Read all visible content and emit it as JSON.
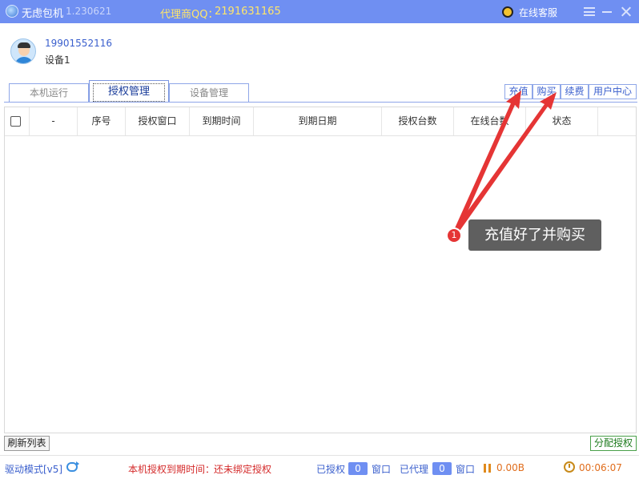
{
  "titlebar": {
    "app_name": "无虑包机",
    "version": "1.230621",
    "agent_label": "代理商QQ：",
    "agent_qq": "2191631165",
    "service_label": "在线客服"
  },
  "user": {
    "phone": "19901552116",
    "device": "设备1"
  },
  "tabs": [
    {
      "label": "本机运行"
    },
    {
      "label": "授权管理"
    },
    {
      "label": "设备管理"
    }
  ],
  "actions": {
    "recharge": "充值",
    "buy": "购买",
    "renew": "续费",
    "user_center": "用户中心"
  },
  "table": {
    "columns": [
      "-",
      "序号",
      "授权窗口",
      "到期时间",
      "到期日期",
      "授权台数",
      "在线台数",
      "状态"
    ]
  },
  "bottom": {
    "refresh": "刷新列表",
    "assign": "分配授权"
  },
  "status": {
    "drive_mode": "驱动模式[v5]",
    "expire_label": "本机授权到期时间：",
    "expire_value": "还未绑定授权",
    "authorized_label": "已授权",
    "authorized_count": "0",
    "window_label": "窗口",
    "proxy_label": "已代理",
    "proxy_count": "0",
    "traffic": "0.00B",
    "uptime": "00:06:07"
  },
  "annotation": {
    "number": "1",
    "text": "充值好了并购买"
  },
  "colors": {
    "titlebar": "#6f8ff2",
    "accent_text": "#3a5fcd",
    "warning_red": "#d42a2a",
    "annotation_red": "#e53535"
  }
}
